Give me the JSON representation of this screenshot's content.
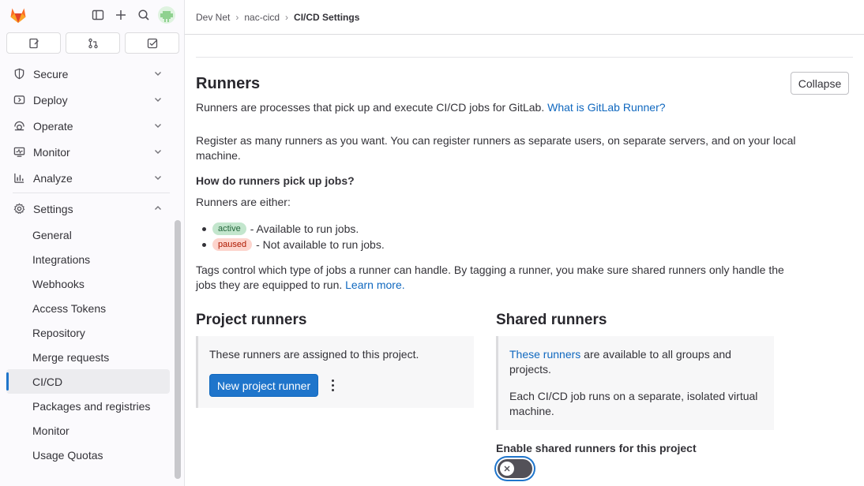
{
  "breadcrumb": {
    "group": "Dev Net",
    "project": "nac-cicd",
    "current": "CI/CD Settings"
  },
  "sidebar": {
    "tabs": [
      "issues-icon",
      "merge-requests-icon",
      "todo-icon"
    ],
    "nav": [
      {
        "label": "Secure",
        "icon": "shield-icon"
      },
      {
        "label": "Deploy",
        "icon": "deploy-icon"
      },
      {
        "label": "Operate",
        "icon": "operate-icon"
      },
      {
        "label": "Monitor",
        "icon": "monitor-icon"
      },
      {
        "label": "Analyze",
        "icon": "analyze-icon"
      }
    ],
    "settings": {
      "label": "Settings",
      "icon": "gear-icon"
    },
    "sub": [
      {
        "label": "General"
      },
      {
        "label": "Integrations"
      },
      {
        "label": "Webhooks"
      },
      {
        "label": "Access Tokens"
      },
      {
        "label": "Repository"
      },
      {
        "label": "Merge requests"
      },
      {
        "label": "CI/CD",
        "active": true
      },
      {
        "label": "Packages and registries"
      },
      {
        "label": "Monitor"
      },
      {
        "label": "Usage Quotas"
      }
    ]
  },
  "runners": {
    "title": "Runners",
    "collapse_label": "Collapse",
    "intro_text": "Runners are processes that pick up and execute CI/CD jobs for GitLab.",
    "intro_link": "What is GitLab Runner?",
    "register_text": "Register as many runners as you want. You can register runners as separate users, on separate servers, and on your local",
    "register_text_2": "machine.",
    "how_heading": "How do runners pick up jobs?",
    "either_text": "Runners are either:",
    "states": [
      {
        "badge": "active",
        "text": "- Available to run jobs."
      },
      {
        "badge": "paused",
        "text": "- Not available to run jobs."
      }
    ],
    "tags_text": "Tags control which type of jobs a runner can handle. By tagging a runner, you make sure shared runners only handle the",
    "tags_text_2": "jobs they are equipped to run.",
    "tags_link": "Learn more."
  },
  "project_runners": {
    "title": "Project runners",
    "box_text": "These runners are assigned to this project.",
    "new_button": "New project runner"
  },
  "shared_runners": {
    "title": "Shared runners",
    "box_link": "These runners",
    "box_text": "are available to all groups and",
    "box_text_2": "projects.",
    "box_text_3": "Each CI/CD job runs on a separate, isolated virtual",
    "box_text_4": "machine.",
    "enable_label": "Enable shared runners for this project"
  },
  "colors": {
    "primary": "#1f75cb",
    "link": "#1068bf",
    "active_badge": "#c3e6cd",
    "paused_badge": "#fdd4cd"
  }
}
